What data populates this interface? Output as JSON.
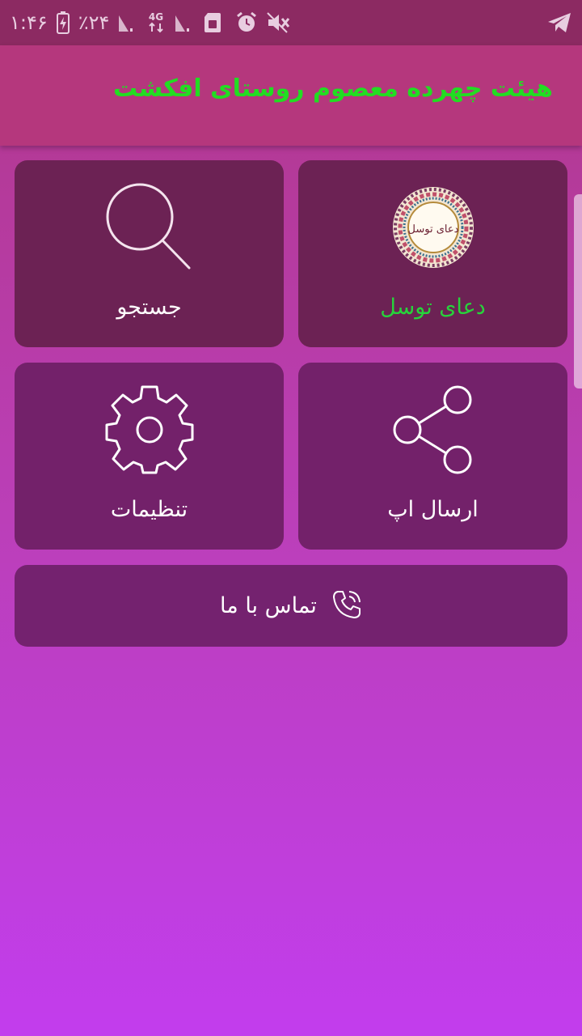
{
  "status_bar": {
    "time": "۱:۴۶",
    "battery": "٪۲۴",
    "network": "4G",
    "icons": [
      "battery-charging-icon",
      "signal-icon",
      "network-4g-icon",
      "signal-icon",
      "sim-card-icon",
      "alarm-icon",
      "mute-icon",
      "telegram-icon"
    ]
  },
  "app_bar": {
    "title": "هیئت چهرده معصوم روستای افکشت"
  },
  "tiles": [
    {
      "id": "tawassul",
      "label": "دعای توسل",
      "icon": "dua-tawassul-emblem-icon",
      "emblem_text": "دعای توسل",
      "label_color": "#27d33b"
    },
    {
      "id": "search",
      "label": "جستجو",
      "icon": "search-icon"
    },
    {
      "id": "share",
      "label": "ارسال اپ",
      "icon": "share-icon"
    },
    {
      "id": "settings",
      "label": "تنظیمات",
      "icon": "gear-icon"
    }
  ],
  "contact": {
    "label": "تماس با ما",
    "icon": "phone-icon"
  },
  "colors": {
    "status_bar": "#8c2a62",
    "app_bar": "#b5377d",
    "title": "#22dd22",
    "tile": "#6c2254",
    "background_top": "#b1378a",
    "background_bottom": "#c23ded"
  }
}
